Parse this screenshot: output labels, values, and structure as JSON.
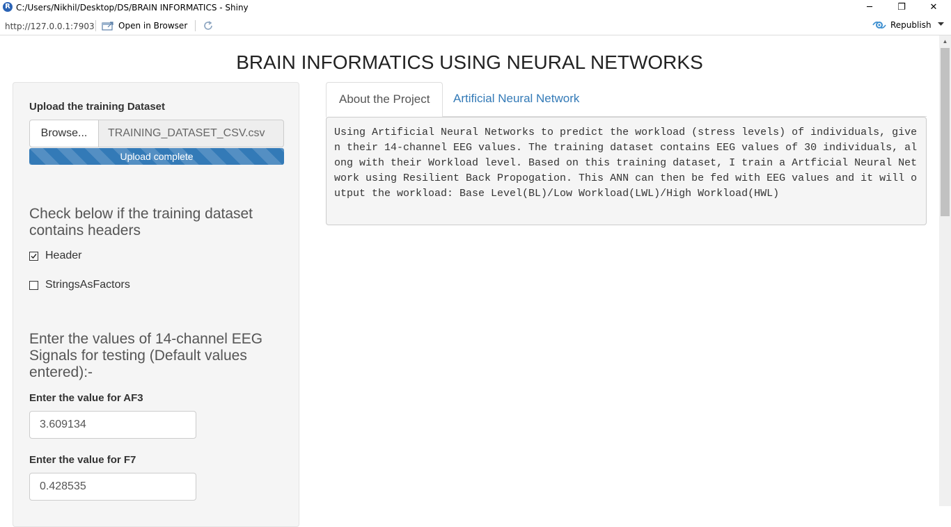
{
  "window": {
    "title": "C:/Users/Nikhil/Desktop/DS/BRAIN INFORMATICS - Shiny",
    "app_icon_letter": "R",
    "minimize": "─",
    "restore": "❐",
    "close": "✕"
  },
  "toolbar": {
    "url": "http://127.0.0.1:7903",
    "open_in_browser": "Open in Browser",
    "republish": "Republish"
  },
  "page": {
    "title": "BRAIN INFORMATICS USING NEURAL NETWORKS"
  },
  "sidebar": {
    "upload_label": "Upload the training Dataset",
    "browse_button": "Browse...",
    "file_name": "TRAINING_DATASET_CSV.csv",
    "upload_status": "Upload complete",
    "upload_progress": 1.0,
    "headers_heading": "Check below if the training dataset contains headers",
    "checkboxes": [
      {
        "label": "Header",
        "checked": true
      },
      {
        "label": "StringsAsFactors",
        "checked": false
      }
    ],
    "eeg_heading": "Enter the values of 14-channel EEG Signals for testing (Default values entered):-",
    "inputs": [
      {
        "label": "Enter the value for AF3",
        "value": "3.609134"
      },
      {
        "label": "Enter the value for F7",
        "value": "0.428535"
      }
    ]
  },
  "tabs": [
    {
      "label": "About the Project",
      "active": true
    },
    {
      "label": "Artificial Neural Network",
      "active": false
    }
  ],
  "about_text": "Using Artificial Neural Networks to predict the workload (stress levels) of individuals, given their 14-channel EEG values. The training dataset contains EEG values of 30 individuals, along with their Workload level. Based on this training dataset, I train a Artficial Neural Network using Resilient Back Propogation. This ANN can then be fed with EEG values and it will output the workload: Base Level(BL)/Low Workload(LWL)/High Workload(HWL)",
  "colors": {
    "link_blue": "#337ab7",
    "progress_blue": "#337ab7",
    "well_bg": "#f5f5f5"
  },
  "icons": {
    "app": "r-logo-icon",
    "open_browser": "browser-window-icon",
    "refresh": "refresh-icon",
    "republish": "publish-icon",
    "checkbox_checked": "check-icon"
  }
}
